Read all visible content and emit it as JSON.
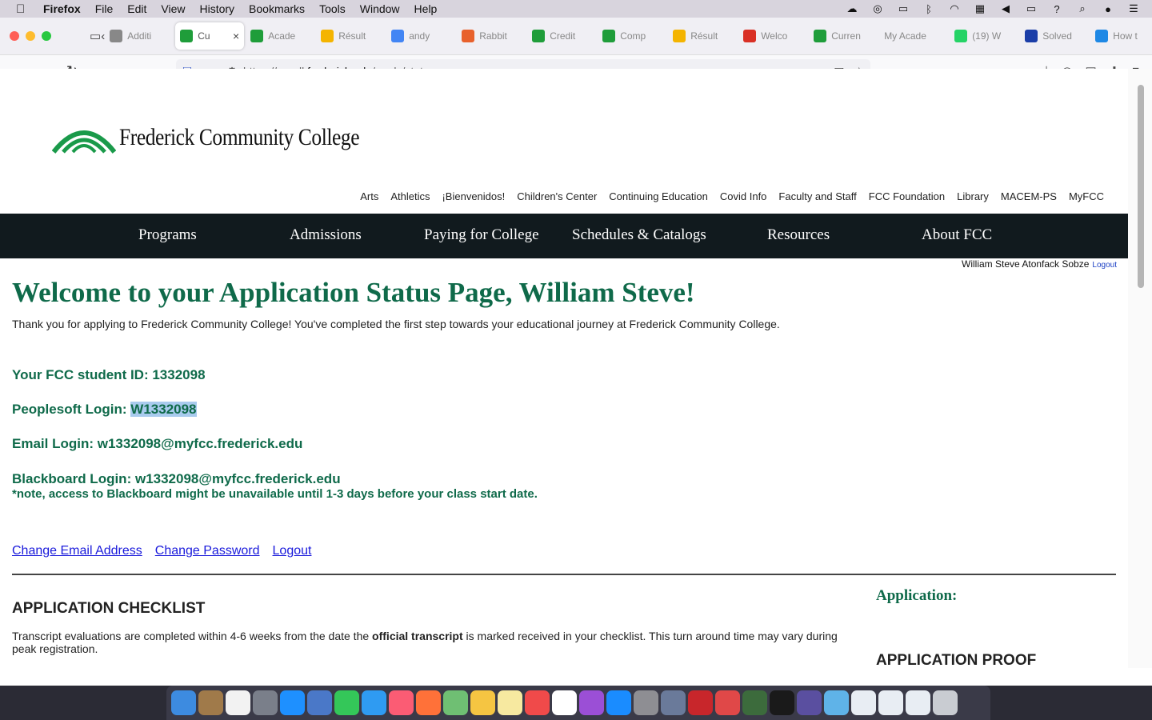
{
  "menubar": {
    "app_name": "Firefox",
    "items": [
      "File",
      "Edit",
      "View",
      "History",
      "Bookmarks",
      "Tools",
      "Window",
      "Help"
    ]
  },
  "tabs": [
    {
      "title": "Additi",
      "favicon": "#888888"
    },
    {
      "title": "Cu",
      "favicon": "#1f9d3a",
      "active": true
    },
    {
      "title": "Acade",
      "favicon": "#1f9d3a"
    },
    {
      "title": "Résult",
      "favicon": "#f4b400"
    },
    {
      "title": "andy",
      "favicon": "#4285f4"
    },
    {
      "title": "Rabbit",
      "favicon": "#e8612c"
    },
    {
      "title": "Credit",
      "favicon": "#1f9d3a"
    },
    {
      "title": "Comp",
      "favicon": "#1f9d3a"
    },
    {
      "title": "Résult",
      "favicon": "#f4b400"
    },
    {
      "title": "Welco",
      "favicon": "#d93025"
    },
    {
      "title": "Curren",
      "favicon": "#1f9d3a"
    },
    {
      "title": "My Acade",
      "favicon": ""
    },
    {
      "title": "(19) W",
      "favicon": "#25d366"
    },
    {
      "title": "Solved",
      "favicon": "#1b3ea8"
    },
    {
      "title": "How t",
      "favicon": "#1e88e5"
    }
  ],
  "url": {
    "prefix": "https://enroll.",
    "host": "frederick.edu",
    "path": "/apply/status"
  },
  "site": {
    "logo_text": "Frederick Community College",
    "top_links": [
      "Arts",
      "Athletics",
      "¡Bienvenidos!",
      "Children's Center",
      "Continuing Education",
      "Covid Info",
      "Faculty and Staff",
      "FCC Foundation",
      "Library",
      "MACEM-PS",
      "MyFCC"
    ],
    "main_nav": [
      "Programs",
      "Admissions",
      "Paying for College",
      "Schedules & Catalogs",
      "Resources",
      "About FCC"
    ],
    "user_name": "William Steve Atonfack Sobze",
    "logout_small": "Logout"
  },
  "content": {
    "heading": "Welcome to your Application Status Page, William Steve!",
    "thanks": "Thank you for applying to Frederick Community College! You've completed the first step towards your educational journey at Frederick Community College.",
    "student_id_label": "Your FCC student ID: ",
    "student_id": "1332098",
    "peoplesoft_label": "Peoplesoft Login: ",
    "peoplesoft_login": "W1332098",
    "email_label": "Email Login: ",
    "email_login": "w1332098@myfcc.frederick.edu",
    "blackboard_label": "Blackboard Login: ",
    "blackboard_login": "w1332098@myfcc.frederick.edu",
    "note": "*note, access to Blackboard might be unavailable until 1-3 days before your class start date.",
    "link_change_email": "Change Email Address",
    "link_change_password": "Change Password",
    "link_logout": "Logout",
    "checklist_heading": "APPLICATION CHECKLIST",
    "checklist_text_before": "Transcript evaluations are completed within 4-6 weeks from the date the ",
    "checklist_text_bold": "official transcript",
    "checklist_text_after": " is marked received in your checklist. This turn around time may vary during peak registration.",
    "application_label": "Application:",
    "proof_heading": "APPLICATION PROOF"
  },
  "colors": {
    "brand_green": "#0f6a4a",
    "nav_bg": "#111a1e",
    "link_blue": "#1a1adb"
  }
}
